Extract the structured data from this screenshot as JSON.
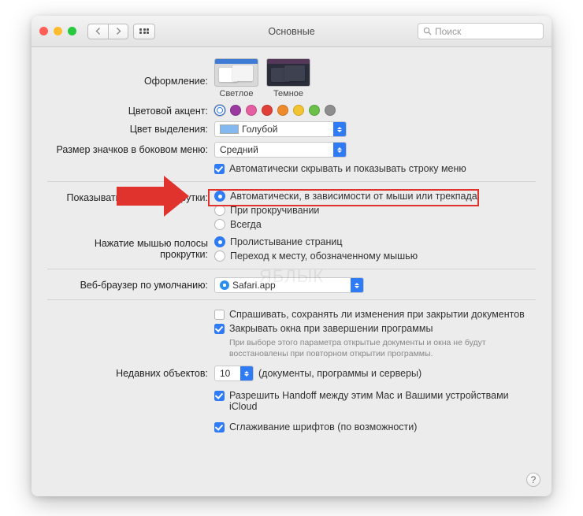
{
  "titlebar": {
    "title": "Основные",
    "search_placeholder": "Поиск"
  },
  "appearance": {
    "label": "Оформление:",
    "light": "Светлое",
    "dark": "Темное"
  },
  "accent": {
    "label": "Цветовой акцент:",
    "colors": [
      "#2f7af5",
      "#9a3aa0",
      "#e45ea0",
      "#e04038",
      "#ef8a2c",
      "#f2c431",
      "#6cc04a",
      "#8e8e8e"
    ],
    "selected_index": 0
  },
  "highlight_color": {
    "label": "Цвет выделения:",
    "value": "Голубой"
  },
  "sidebar_icon": {
    "label": "Размер значков в боковом меню:",
    "value": "Средний"
  },
  "autohide": {
    "label": "Автоматически скрывать и показывать строку меню",
    "checked": true
  },
  "scrollbars": {
    "label": "Показывать полосы прокрутки:",
    "options": [
      "Автоматически, в зависимости от мыши или трекпада",
      "При прокручивании",
      "Всегда"
    ],
    "selected_index": 0
  },
  "scroll_click": {
    "label": "Нажатие мышью полосы прокрутки:",
    "options": [
      "Пролистывание страниц",
      "Переход к месту, обозначенному мышью"
    ],
    "selected_index": 0
  },
  "browser": {
    "label": "Веб-браузер по умолчанию:",
    "value": "Safari.app"
  },
  "ask_save": {
    "label": "Спрашивать, сохранять ли изменения при закрытии документов",
    "checked": false
  },
  "close_windows": {
    "label": "Закрывать окна при завершении программы",
    "sub": "При выборе этого параметра открытые документы и окна не будут восстановлены при повторном открытии программы.",
    "checked": true
  },
  "recent": {
    "label": "Недавних объектов:",
    "value": "10",
    "suffix": "(документы, программы и серверы)"
  },
  "handoff": {
    "label": "Разрешить Handoff между этим Mac и Вашими устройствами iCloud",
    "checked": true
  },
  "font_smoothing": {
    "label": "Сглаживание шрифтов (по возможности)",
    "checked": true
  },
  "watermark": "ЯБЛЫК"
}
